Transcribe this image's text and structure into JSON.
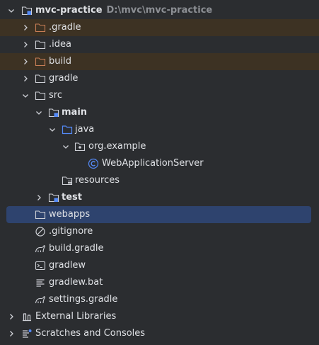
{
  "project": {
    "name": "mvc-practice",
    "path": "D:\\mvc\\mvc-practice"
  },
  "tree": {
    "gradle_hidden": ".gradle",
    "idea": ".idea",
    "build": "build",
    "gradle": "gradle",
    "src": "src",
    "main": "main",
    "java": "java",
    "package": "org.example",
    "class": "WebApplicationServer",
    "resources": "resources",
    "test": "test",
    "webapps": "webapps",
    "gitignore": ".gitignore",
    "build_gradle": "build.gradle",
    "gradlew": "gradlew",
    "gradlew_bat": "gradlew.bat",
    "settings_gradle": "settings.gradle",
    "external_libraries": "External Libraries",
    "scratches": "Scratches and Consoles"
  },
  "colors": {
    "background": "#2b2d30",
    "text": "#dfe1e5",
    "muted_path": "#8c8f94",
    "excluded_row": "#3d3223",
    "selected_row": "#2e436e",
    "folder_excluded": "#c77d55",
    "source_folder": "#548af7"
  }
}
